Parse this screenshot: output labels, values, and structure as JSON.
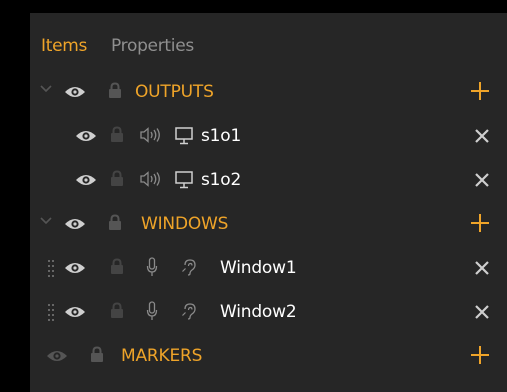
{
  "tabs": {
    "items_label": "Items",
    "properties_label": "Properties"
  },
  "tree": {
    "outputs": {
      "label": "OUTPUTS",
      "children": [
        {
          "label": "s1o1"
        },
        {
          "label": "s1o2"
        }
      ]
    },
    "windows": {
      "label": "WINDOWS",
      "children": [
        {
          "label": "Window1"
        },
        {
          "label": "Window2"
        }
      ]
    },
    "markers": {
      "label": "MARKERS"
    }
  },
  "colors": {
    "accent": "#efa429",
    "panel_background": "#262626",
    "inactive_tab": "#8f8f8f",
    "item_text": "#ffffff",
    "icon_light": "#cfcfcf",
    "icon_dim": "#555555"
  },
  "icons": {
    "expand": "chevron-down-icon",
    "visibility": "eye-icon",
    "lock": "lock-icon",
    "audio": "speaker-icon",
    "display": "monitor-icon",
    "microphone": "microphone-icon",
    "hearing": "ear-icon",
    "drag": "drag-handle-icon",
    "add": "plus-icon",
    "remove": "close-icon"
  }
}
